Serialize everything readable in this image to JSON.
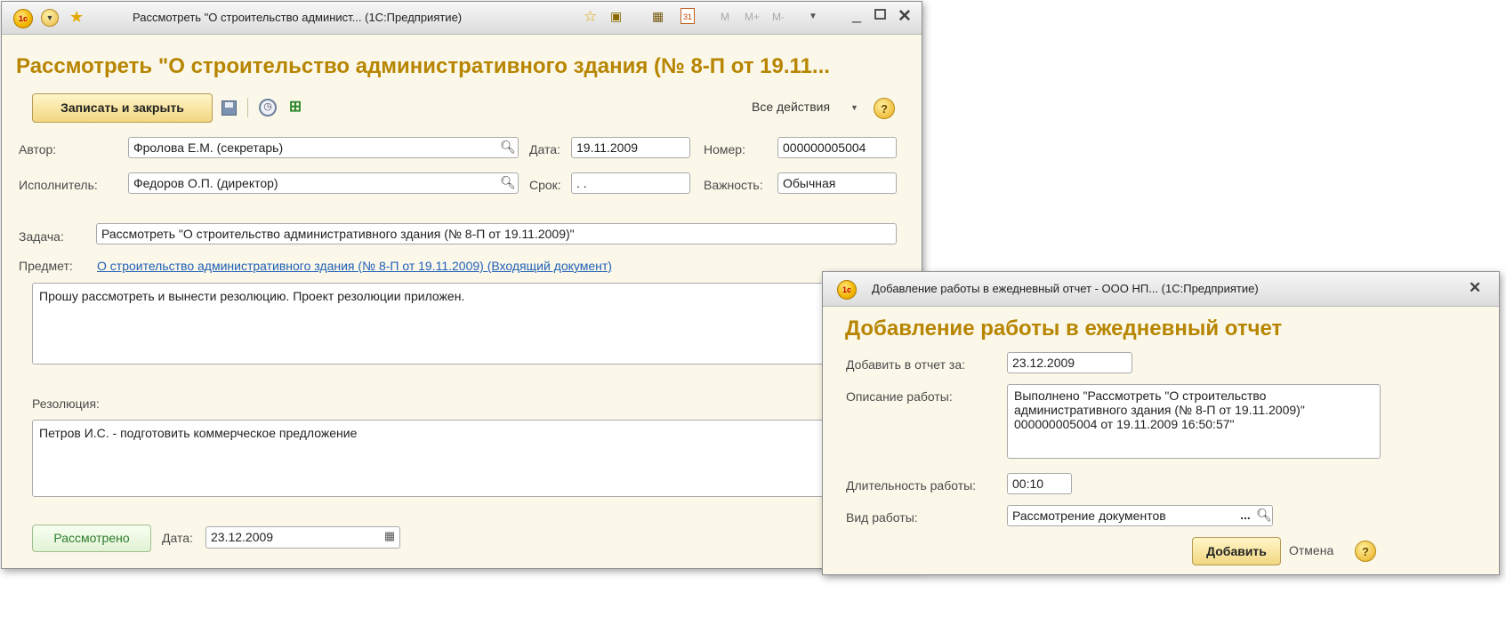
{
  "main_window": {
    "title_bar": {
      "title": "Рассмотреть \"О строительство админист... (1С:Предприятие)",
      "logo_text": "1c",
      "memory_buttons": [
        "M",
        "M+",
        "M-"
      ]
    },
    "form_title": "Рассмотреть \"О строительство административного здания (№ 8-П от 19.11...",
    "toolbar": {
      "write_close": "Записать и закрыть",
      "all_actions": "Все действия",
      "help": "?"
    },
    "fields": {
      "author_label": "Автор:",
      "author_value": "Фролова Е.М. (секретарь)",
      "date_label": "Дата:",
      "date_value": "19.11.2009",
      "number_label": "Номер:",
      "number_value": "000000005004",
      "executor_label": "Исполнитель:",
      "executor_value": "Федоров О.П. (директор)",
      "term_label": "Срок:",
      "term_value": " .  .",
      "importance_label": "Важность:",
      "importance_value": "Обычная",
      "task_label": "Задача:",
      "task_value": "Рассмотреть \"О строительство административного здания (№ 8-П от 19.11.2009)\"",
      "subject_label": "Предмет:",
      "subject_link": "О строительство административного здания (№ 8-П от 19.11.2009) (Входящий документ)",
      "description": "Прошу рассмотреть и вынести резолюцию. Проект резолюции приложен.",
      "resolution_label": "Резолюция:",
      "resolution_value": "Петров И.С. - подготовить коммерческое предложение"
    },
    "footer": {
      "reviewed_button": "Рассмотрено",
      "date_label": "Дата:",
      "date_value": "23.12.2009"
    }
  },
  "dialog": {
    "title_bar": {
      "title": "Добавление работы в ежедневный отчет - ООО НП... (1С:Предприятие)",
      "logo_text": "1c"
    },
    "form_title": "Добавление работы в ежедневный отчет",
    "fields": {
      "report_date_label": "Добавить в отчет за:",
      "report_date_value": "23.12.2009",
      "description_label": "Описание работы:",
      "description_value": "Выполнено \"Рассмотреть \"О строительство административного здания (№ 8-П от 19.11.2009)\" 000000005004 от 19.11.2009 16:50:57\"",
      "duration_label": "Длительность работы:",
      "duration_value": "00:10",
      "work_type_label": "Вид работы:",
      "work_type_value": "Рассмотрение документов",
      "ellipsis": "..."
    },
    "buttons": {
      "add": "Добавить",
      "cancel": "Отмена",
      "help": "?"
    }
  }
}
